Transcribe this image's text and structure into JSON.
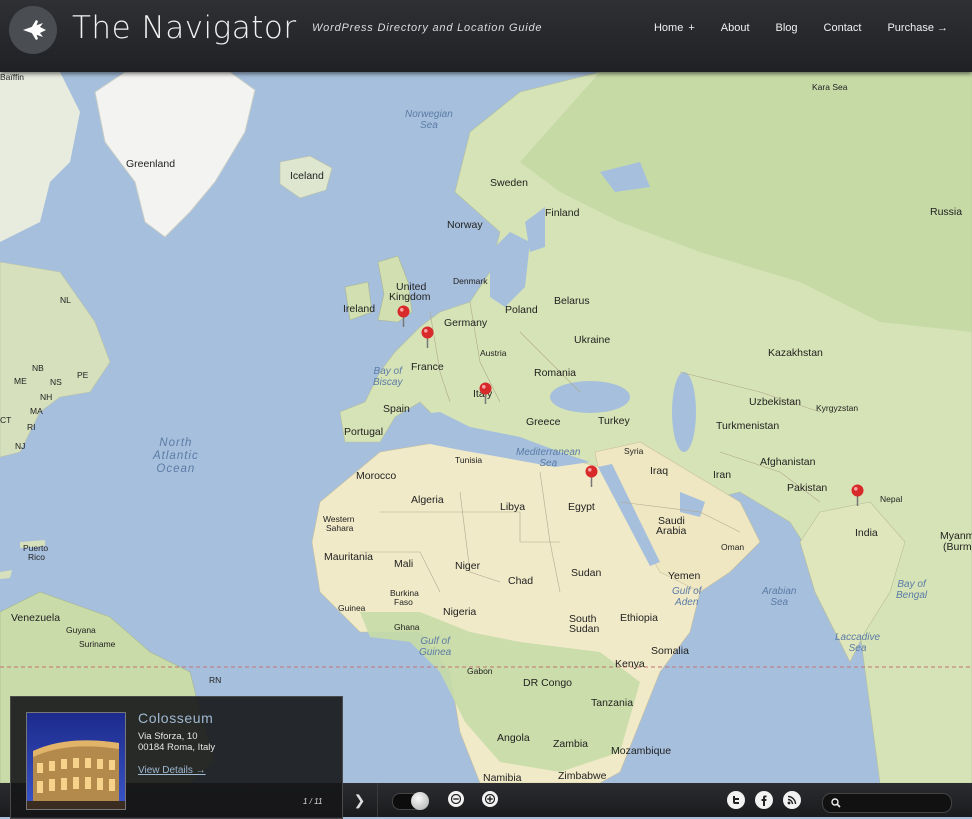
{
  "header": {
    "title": "The Navigator",
    "tagline": "WordPress Directory and Location Guide",
    "nav": [
      {
        "label": "Home",
        "suffix": "+"
      },
      {
        "label": "About"
      },
      {
        "label": "Blog"
      },
      {
        "label": "Contact"
      },
      {
        "label": "Purchase →"
      }
    ]
  },
  "map": {
    "countries": [
      "Greenland",
      "Iceland",
      "Sweden",
      "Finland",
      "Norway",
      "Russia",
      "United",
      "Kingdom",
      "Ireland",
      "Denmark",
      "Belarus",
      "Poland",
      "Germany",
      "Ukraine",
      "Austria",
      "France",
      "Kazakhstan",
      "Romania",
      "Italy",
      "Spain",
      "Uzbekistan",
      "Kyrgyzstan",
      "Portugal",
      "Greece",
      "Turkey",
      "Turkmenistan",
      "Syria",
      "Tunisia",
      "Iraq",
      "Iran",
      "Afghanistan",
      "Morocco",
      "Algeria",
      "Libya",
      "Egypt",
      "Pakistan",
      "Nepal",
      "Western",
      "Sahara",
      "Saudi",
      "Arabia",
      "India",
      "Oman",
      "Myanm",
      "(Burm",
      "Mauritania",
      "Mali",
      "Niger",
      "Chad",
      "Sudan",
      "Puerto",
      "Rico",
      "Yemen",
      "Burkina",
      "Faso",
      "Guinea",
      "Nigeria",
      "South",
      "Sudan",
      "Ethiopia",
      "Venezuela",
      "Guyana",
      "Suriname",
      "Ghana",
      "Somalia",
      "Kenya",
      "Gabon",
      "DR Congo",
      "Tanzania",
      "Angola",
      "Zambia",
      "Mozambique",
      "Namibia",
      "Zimbabwe",
      "NL",
      "NB",
      "PE",
      "NS",
      "ME",
      "NH",
      "MA",
      "RI",
      "CT",
      "NJ",
      "RN",
      "Baïffin",
      "Kara Sea"
    ],
    "seas": {
      "norwegian": [
        "Norwegian",
        "Sea"
      ],
      "biscay": [
        "Bay of",
        "Biscay"
      ],
      "atlantic": [
        "North",
        "Atlantic",
        "Ocean"
      ],
      "mediterranean": [
        "Mediterranean",
        "Sea"
      ],
      "aden": [
        "Gulf of",
        "Aden"
      ],
      "arabian": [
        "Arabian",
        "Sea"
      ],
      "bengal": [
        "Bay of",
        "Bengal"
      ],
      "laccadive": [
        "Laccadive",
        "Sea"
      ],
      "guinea": [
        "Gulf of",
        "Guinea"
      ]
    },
    "markers": [
      "London",
      "Paris",
      "Rome",
      "Cairo",
      "Delhi"
    ]
  },
  "card": {
    "title": "Colosseum",
    "address_line1": "Via Sforza, 10",
    "address_line2": "00184 Roma, Italy",
    "details_label": "View Details →",
    "current": "1",
    "total": "11"
  },
  "bar": {
    "next_icon": "chevron-right-icon",
    "social": [
      "twitter-icon",
      "facebook-icon",
      "rss-icon"
    ],
    "search_placeholder": ""
  },
  "colors": {
    "water": "#a6bfdc",
    "land": "#dde4c8",
    "desert": "#f3ecc8",
    "forest": "#c4d8a4",
    "ice": "#f3f4f2",
    "accent": "#9fb9d3",
    "marker": "#d82a2a"
  }
}
